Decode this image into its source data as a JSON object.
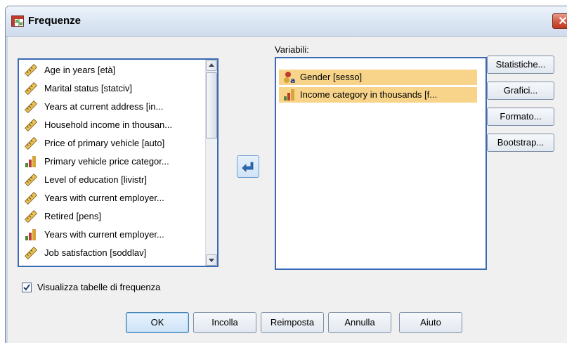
{
  "window": {
    "title": "Frequenze",
    "close_glyph": "✕"
  },
  "source_list": {
    "items": [
      {
        "label": "Age in years [età]",
        "icon": "scale-ruler-icon"
      },
      {
        "label": "Marital status [statciv]",
        "icon": "scale-ruler-icon"
      },
      {
        "label": "Years at current address [in...",
        "icon": "scale-ruler-icon"
      },
      {
        "label": "Household income in thousan...",
        "icon": "scale-ruler-icon"
      },
      {
        "label": "Price of primary vehicle [auto]",
        "icon": "scale-ruler-icon"
      },
      {
        "label": "Primary vehicle price categor...",
        "icon": "ordinal-bars-icon"
      },
      {
        "label": "Level of education [livistr]",
        "icon": "scale-ruler-icon"
      },
      {
        "label": "Years with current employer...",
        "icon": "scale-ruler-icon"
      },
      {
        "label": "Retired [pens]",
        "icon": "scale-ruler-icon"
      },
      {
        "label": "Years with current employer...",
        "icon": "ordinal-bars-icon"
      },
      {
        "label": "Job satisfaction [soddlav]",
        "icon": "scale-ruler-icon"
      }
    ]
  },
  "target_list": {
    "label": "Variabili:",
    "items": [
      {
        "label": "Gender [sesso]",
        "icon": "nominal-icon"
      },
      {
        "label": "Income category in thousands [f...",
        "icon": "ordinal-bars-icon"
      }
    ]
  },
  "side_buttons": {
    "statistics": "Statistiche...",
    "charts": "Grafici...",
    "format": "Formato...",
    "bootstrap": "Bootstrap..."
  },
  "checkbox": {
    "label": "Visualizza tabelle di frequenza",
    "checked": true
  },
  "bottom_buttons": {
    "ok": "OK",
    "paste": "Incolla",
    "reset": "Reimposta",
    "cancel": "Annulla",
    "help": "Aiuto"
  },
  "colors": {
    "selection": "#f7d48a",
    "list_border": "#3b6ab4",
    "close_red": "#c03a20"
  }
}
